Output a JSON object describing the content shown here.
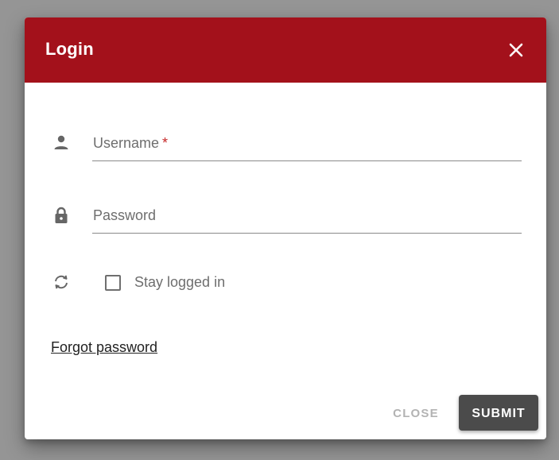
{
  "dialog": {
    "title": "Login",
    "close_icon": "close-icon",
    "colors": {
      "header": "#a3111b",
      "submit": "#4b4b4b",
      "backdrop": "#959595"
    }
  },
  "form": {
    "username": {
      "label": "Username",
      "required_mark": "*",
      "value": "",
      "icon": "person-icon"
    },
    "password": {
      "label": "Password",
      "value": "",
      "icon": "lock-icon"
    },
    "stay_logged_in": {
      "label": "Stay logged in",
      "checked": false,
      "icon": "sync-icon"
    },
    "forgot_password": "Forgot password"
  },
  "actions": {
    "close_label": "CLOSE",
    "submit_label": "SUBMIT"
  }
}
